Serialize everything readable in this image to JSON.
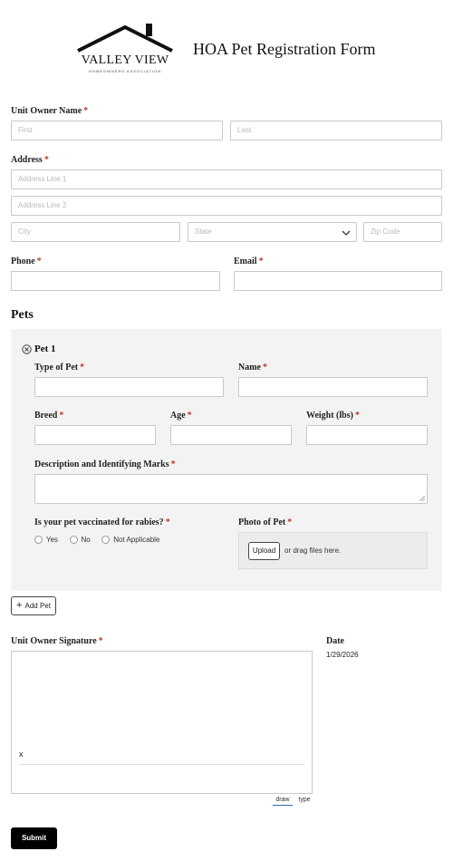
{
  "header": {
    "logo_main": "VALLEY VIEW",
    "logo_sub": "HOMEOWNERS ASSOCIATION",
    "title": "HOA Pet Registration Form"
  },
  "owner_name": {
    "label": "Unit Owner Name",
    "required": "*",
    "first_placeholder": "First",
    "last_placeholder": "Last"
  },
  "address": {
    "label": "Address",
    "required": "*",
    "line1_placeholder": "Address Line 1",
    "line2_placeholder": "Address Line 2",
    "city_placeholder": "City",
    "state_placeholder": "State",
    "zip_placeholder": "Zip Code"
  },
  "phone": {
    "label": "Phone",
    "required": "*"
  },
  "email": {
    "label": "Email",
    "required": "*"
  },
  "pets": {
    "heading": "Pets",
    "pet_title": "Pet 1",
    "type_label": "Type of Pet",
    "name_label": "Name",
    "breed_label": "Breed",
    "age_label": "Age",
    "weight_label": "Weight (lbs)",
    "description_label": "Description and Identifying Marks",
    "rabies_label": "Is your pet vaccinated for rabies?",
    "rabies_options": [
      "Yes",
      "No",
      "Not Applicable"
    ],
    "photo_label": "Photo of Pet",
    "upload_button": "Upload",
    "upload_hint": "or drag files here.",
    "required": "*"
  },
  "add_pet_button": "Add Pet",
  "signature": {
    "label": "Unit Owner Signature",
    "required": "*",
    "x_mark": "x",
    "tab_draw": "draw",
    "tab_type": "type"
  },
  "date": {
    "label": "Date",
    "value": "1/29/2026"
  },
  "submit_button": "Submit",
  "colors": {
    "required": "#c0392b",
    "accent": "#2b6cb0",
    "pet_panel": "#f3f3f3"
  }
}
